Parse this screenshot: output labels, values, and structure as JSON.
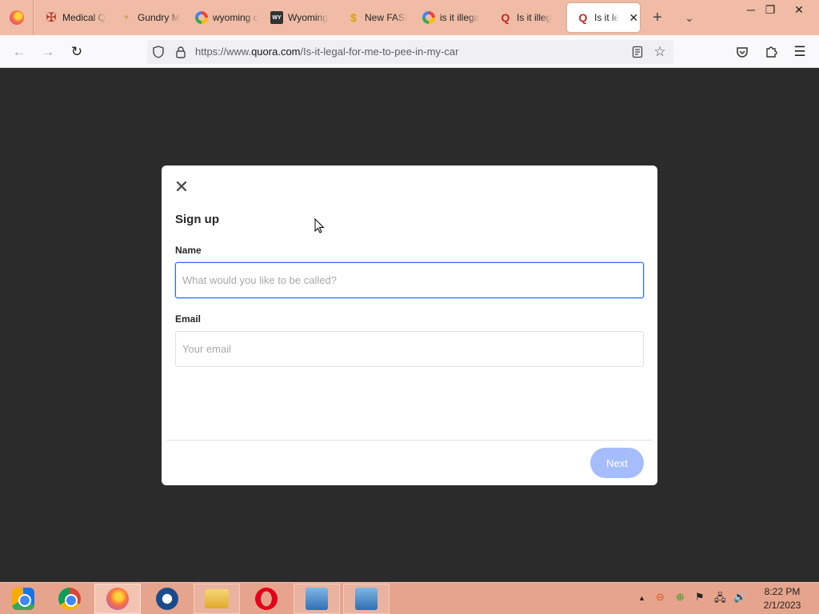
{
  "tabs": [
    {
      "title": "Medical Q",
      "favicon": "medical-favicon"
    },
    {
      "title": "Gundry M",
      "favicon": "gundry-favicon"
    },
    {
      "title": "wyoming c",
      "favicon": "google-favicon"
    },
    {
      "title": "Wyoming",
      "favicon": "wyoming-favicon"
    },
    {
      "title": "New FASI",
      "favicon": "fasi-favicon"
    },
    {
      "title": "is it illega",
      "favicon": "google-favicon"
    },
    {
      "title": "Is it illeg",
      "favicon": "quora-favicon"
    },
    {
      "title": "Is it le",
      "favicon": "quora-favicon",
      "active": true
    }
  ],
  "toolbar": {
    "new_tab": "+",
    "list_all_tabs": "⌄",
    "minimize": "─",
    "restore": "❐",
    "close": "✕"
  },
  "urlbar": {
    "prefix": "https://www.",
    "domain": "quora.com",
    "path": "/Is-it-legal-for-me-to-pee-in-my-car"
  },
  "modal": {
    "close_glyph": "✕",
    "title": "Sign up",
    "name_label": "Name",
    "name_placeholder": "What would you like to be called?",
    "name_value": "",
    "email_label": "Email",
    "email_placeholder": "Your email",
    "email_value": "",
    "next_label": "Next",
    "next_enabled": false
  },
  "taskbar": {
    "apps": [
      "chromium-icon",
      "chrome-icon",
      "firefox-icon",
      "openvpn-icon",
      "file-explorer-icon",
      "opera-icon",
      "network-icon",
      "network-icon"
    ],
    "active_app": "firefox-icon",
    "time": "8:22 PM",
    "date": "2/1/2023"
  },
  "colors": {
    "tabstrip": "#f0bca6",
    "accent": "#2e69ff",
    "next_button": "#a5bdfd",
    "overlay": "#2b2b2b"
  }
}
